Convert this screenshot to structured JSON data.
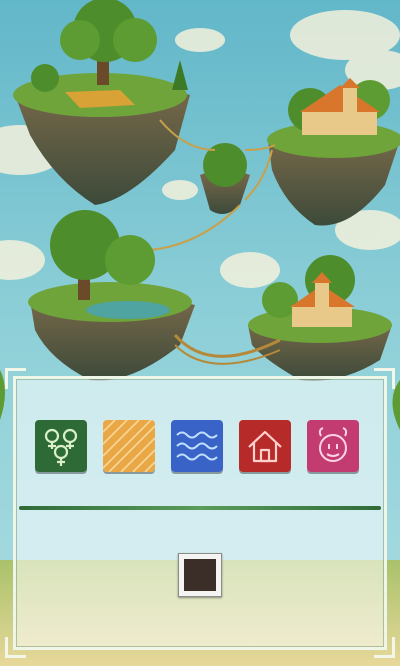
{
  "tiles": [
    {
      "name": "gender-symbols-icon",
      "color": "#2e6a35"
    },
    {
      "name": "diagonal-stripes-icon",
      "color": "#e9a845"
    },
    {
      "name": "waves-icon",
      "color": "#3a63c7"
    },
    {
      "name": "house-icon",
      "color": "#b62a2a"
    },
    {
      "name": "bull-face-icon",
      "color": "#c23c72"
    }
  ],
  "answer_slots": [
    {
      "name": "answer-slot",
      "filled": true
    }
  ]
}
